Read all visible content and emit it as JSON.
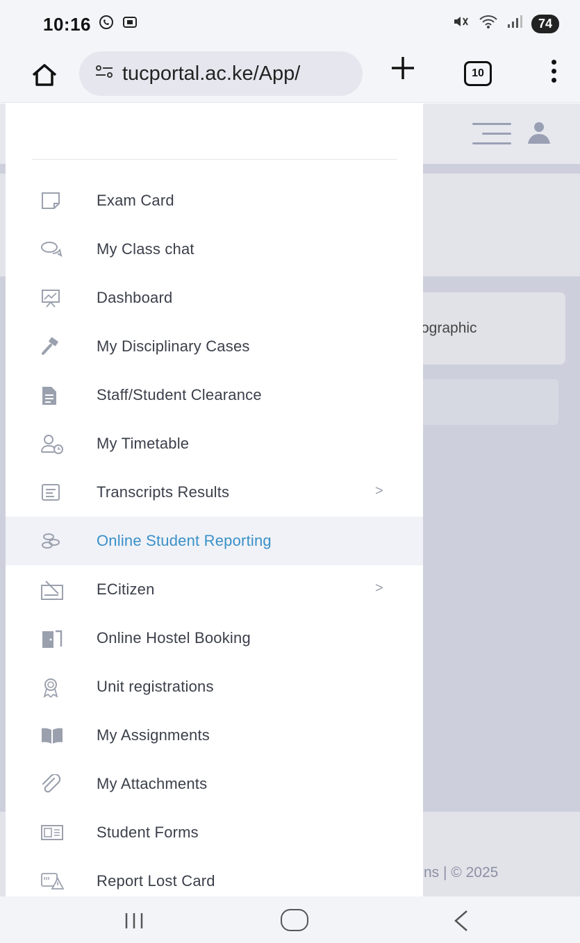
{
  "status_bar": {
    "time": "10:16",
    "battery": "74"
  },
  "browser": {
    "url": "tucportal.ac.ke/App/",
    "tab_count": "10"
  },
  "background": {
    "card_text": "ographic",
    "footer_text": "ns | © 2025"
  },
  "drawer": {
    "items": [
      {
        "label": "Exam Card",
        "icon": "card-icon",
        "chevron": false
      },
      {
        "label": "My Class chat",
        "icon": "chat-icon",
        "chevron": false
      },
      {
        "label": "Dashboard",
        "icon": "presentation-icon",
        "chevron": false
      },
      {
        "label": "My Disciplinary Cases",
        "icon": "gavel-icon",
        "chevron": false
      },
      {
        "label": "Staff/Student Clearance",
        "icon": "document-icon",
        "chevron": false
      },
      {
        "label": "My Timetable",
        "icon": "user-clock-icon",
        "chevron": false
      },
      {
        "label": "Transcripts Results",
        "icon": "transcript-icon",
        "chevron": true
      },
      {
        "label": "Online Student Reporting",
        "icon": "coins-icon",
        "chevron": false,
        "active": true
      },
      {
        "label": "ECitizen",
        "icon": "signature-icon",
        "chevron": true
      },
      {
        "label": "Online Hostel Booking",
        "icon": "door-icon",
        "chevron": false
      },
      {
        "label": "Unit registrations",
        "icon": "award-icon",
        "chevron": false
      },
      {
        "label": "My Assignments",
        "icon": "book-icon",
        "chevron": false
      },
      {
        "label": "My Attachments",
        "icon": "paperclip-icon",
        "chevron": false
      },
      {
        "label": "Student Forms",
        "icon": "form-icon",
        "chevron": false
      },
      {
        "label": "Report Lost Card",
        "icon": "warning-card-icon",
        "chevron": false
      }
    ],
    "chevron_glyph": ">"
  },
  "colors": {
    "accent": "#3a90c8",
    "active_bg": "#f0f2f7",
    "overlay": "#cdd0dc"
  }
}
